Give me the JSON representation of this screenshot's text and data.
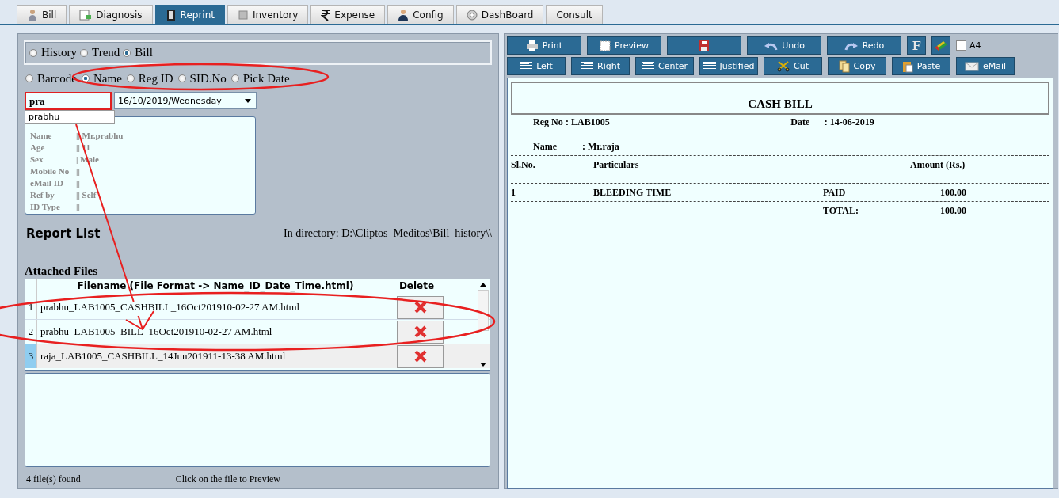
{
  "tabs": [
    {
      "label": "Bill",
      "selected": false
    },
    {
      "label": "Diagnosis",
      "selected": false
    },
    {
      "label": "Reprint",
      "selected": true
    },
    {
      "label": "Inventory",
      "selected": false
    },
    {
      "label": "Expense",
      "selected": false
    },
    {
      "label": "Config",
      "selected": false
    },
    {
      "label": "DashBoard",
      "selected": false
    },
    {
      "label": "Consult",
      "selected": false
    }
  ],
  "view_mode": [
    {
      "label": "History",
      "selected": false
    },
    {
      "label": "Trend",
      "selected": false
    },
    {
      "label": "Bill",
      "selected": true
    }
  ],
  "search_by": [
    {
      "label": "Barcode",
      "selected": false
    },
    {
      "label": "Name",
      "selected": true
    },
    {
      "label": "Reg ID",
      "selected": false
    },
    {
      "label": "SID.No",
      "selected": false
    },
    {
      "label": "Pick Date",
      "selected": false
    }
  ],
  "search_field": {
    "value": "pra"
  },
  "suggestions": [
    "prabhu"
  ],
  "date_dropdown": {
    "value": "16/10/2019/Wednesday"
  },
  "patient_info": [
    {
      "label": "Name",
      "value": "|| Mr.prabhu"
    },
    {
      "label": "Age",
      "value": "|| 11"
    },
    {
      "label": "Sex",
      "value": "| Male"
    },
    {
      "label": "Mobile No",
      "value": "||"
    },
    {
      "label": "eMail ID",
      "value": "||"
    },
    {
      "label": "Ref by",
      "value": "|| Self"
    },
    {
      "label": "ID Type",
      "value": "||"
    }
  ],
  "report_list": {
    "title": "Report List",
    "directory": "In directory:  D:\\Cliptos_Meditos\\Bill_history\\\\"
  },
  "attached_files": {
    "title": "Attached Files",
    "columns": [
      "Filename (File Format -> Name_ID_Date_Time.html)",
      "Delete"
    ],
    "rows": [
      {
        "index": "1",
        "filename": "prabhu_LAB1005_CASHBILL_16Oct201910-02-27 AM.html",
        "selected": false
      },
      {
        "index": "2",
        "filename": "prabhu_LAB1005_BILL_16Oct201910-02-27 AM.html",
        "selected": false
      },
      {
        "index": "3",
        "filename": "raja_LAB1005_CASHBILL_14Jun201911-13-38 AM.html",
        "selected": true
      }
    ]
  },
  "footer": {
    "count": "4 file(s) found",
    "hint": "Click on the file to Preview"
  },
  "toolbar": [
    [
      {
        "label": "Print",
        "kind": "print"
      },
      {
        "label": "Preview",
        "kind": "preview"
      },
      {
        "kind": "pdf"
      },
      {
        "label": "Undo",
        "kind": "undo"
      },
      {
        "label": "Redo",
        "kind": "redo"
      },
      {
        "label": "F",
        "kind": "font"
      },
      {
        "kind": "color"
      }
    ],
    [
      {
        "label": "Left",
        "kind": "left"
      },
      {
        "label": "Right",
        "kind": "right"
      },
      {
        "label": "Center",
        "kind": "center"
      },
      {
        "label": "Justified",
        "kind": "justify"
      },
      {
        "label": "Cut",
        "kind": "cut"
      },
      {
        "label": "Copy",
        "kind": "copy"
      },
      {
        "label": "Paste",
        "kind": "paste"
      },
      {
        "label": "eMail",
        "kind": "mail"
      }
    ]
  ],
  "a4": {
    "label": "A4",
    "checked": false
  },
  "bill": {
    "title": "CASH BILL",
    "reg_no_label": "Reg No",
    "reg_no": ": LAB1005",
    "date_label": "Date",
    "date": ": 14-06-2019",
    "name_label": "Name",
    "name": ": Mr.raja",
    "columns": [
      "Sl.No.",
      "Particulars",
      "Amount (Rs.)"
    ],
    "items": [
      {
        "sl": "1",
        "particular": "BLEEDING TIME",
        "status": "PAID",
        "amount": "100.00"
      }
    ],
    "total_label": "TOTAL:",
    "total": "100.00"
  }
}
